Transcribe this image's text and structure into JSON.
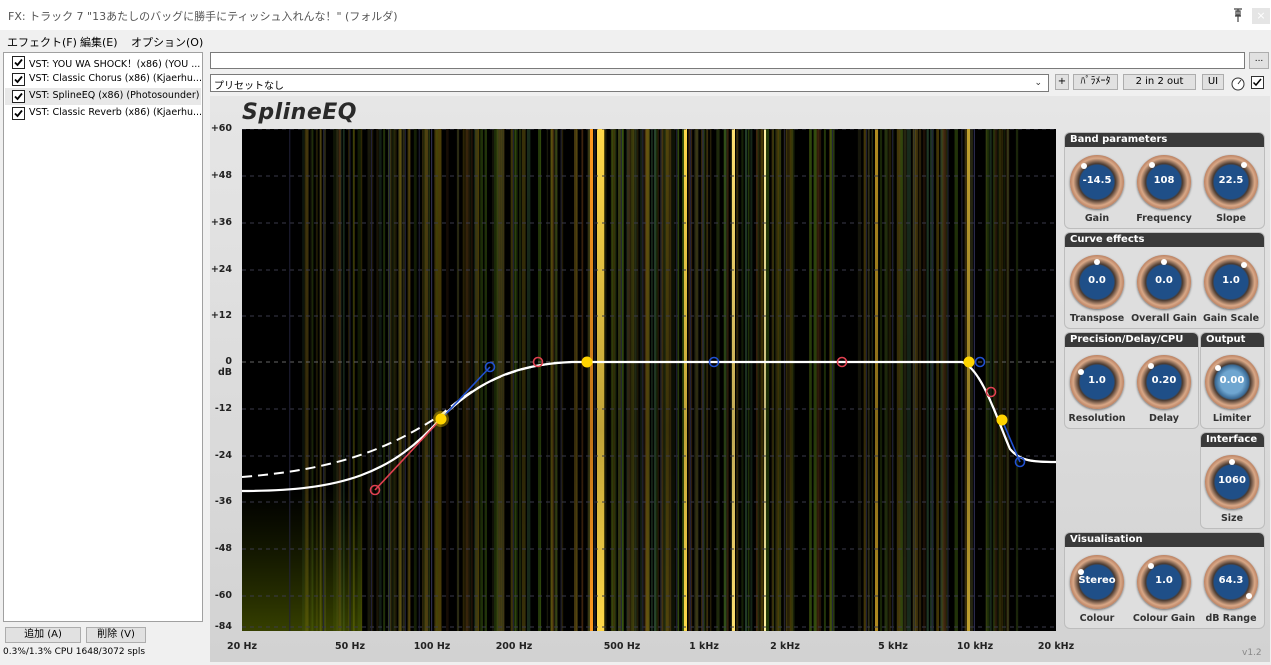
{
  "window": {
    "title": "FX: トラック 7 \"13あたしのバッグに勝手にティッシュ入れんな！\" (フォルダ)",
    "close_label": "×",
    "pin_icon": "pin-icon"
  },
  "menu": [
    {
      "label": "エフェクト(F)"
    },
    {
      "label": "編集(E)"
    },
    {
      "label": "オプション(O)"
    }
  ],
  "fx_list": [
    {
      "label": "VST: YOU WA SHOCK！(x86) (YOU ...",
      "checked": true
    },
    {
      "label": "VST: Classic Chorus (x86) (Kjaerhu...",
      "checked": true
    },
    {
      "label": "VST: SplineEQ (x86) (Photosounder)",
      "checked": true
    },
    {
      "label": "VST: Classic Reverb (x86) (Kjaerhu...",
      "checked": true
    }
  ],
  "buttons": {
    "add": "追加 (A)",
    "remove": "削除 (V)",
    "dots": "...",
    "plus": "+",
    "params": "ﾊﾟﾗﾒｰﾀ",
    "io": "2 in 2 out",
    "ui": "UI"
  },
  "cpu_status": "0.3%/1.3% CPU 1648/3072 spls",
  "preset": {
    "value": "プリセットなし"
  },
  "plugin": {
    "logo": "SplineEQ",
    "version": "v1.2",
    "y_ticks": [
      "+60",
      "+48",
      "+36",
      "+24",
      "+12",
      "0 dB",
      "-12",
      "-24",
      "-36",
      "-48",
      "-60",
      "-84"
    ],
    "x_ticks": [
      "20 Hz",
      "50 Hz",
      "100 Hz",
      "200 Hz",
      "500 Hz",
      "1 kHz",
      "2 kHz",
      "5 kHz",
      "10 kHz",
      "20 kHz"
    ],
    "panels": {
      "band": {
        "title": "Band parameters",
        "knobs": [
          {
            "label": "Gain",
            "value": "-14.5"
          },
          {
            "label": "Frequency",
            "value": "108"
          },
          {
            "label": "Slope",
            "value": "22.5"
          }
        ]
      },
      "curve": {
        "title": "Curve effects",
        "knobs": [
          {
            "label": "Transpose",
            "value": "0.0"
          },
          {
            "label": "Overall Gain",
            "value": "0.0"
          },
          {
            "label": "Gain Scale",
            "value": "1.0"
          }
        ]
      },
      "precision": {
        "title": "Precision/Delay/CPU",
        "knobs": [
          {
            "label": "Resolution",
            "value": "1.0"
          },
          {
            "label": "Delay",
            "value": "0.20"
          }
        ]
      },
      "output": {
        "title": "Output",
        "knobs": [
          {
            "label": "Limiter",
            "value": "0.00"
          }
        ]
      },
      "interface": {
        "title": "Interface",
        "knobs": [
          {
            "label": "Size",
            "value": "1060"
          }
        ]
      },
      "visual": {
        "title": "Visualisation",
        "knobs": [
          {
            "label": "Colour",
            "value": "Stereo"
          },
          {
            "label": "Colour Gain",
            "value": "1.0"
          },
          {
            "label": "dB Range",
            "value": "64.3"
          }
        ]
      }
    }
  },
  "colors": {
    "accent_yellow": "#ffd400",
    "knob_face": "#1f4f88",
    "handle_red": "#e04050",
    "handle_blue": "#2050d0"
  }
}
